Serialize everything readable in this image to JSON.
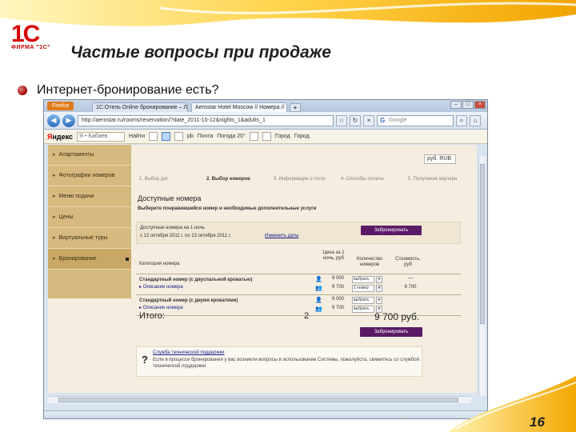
{
  "slide": {
    "title": "Частые вопросы при продаже",
    "bullet": "Интернет-бронирование есть?",
    "page_number": "16",
    "logo": "1С",
    "logo_sub": "ФИРМА \"1С\""
  },
  "browser": {
    "app_button": "Firefox",
    "tabs": [
      "1С:Отель Online бронирование – Л...",
      "Aerostar Hotel Moscow // Номера // ..."
    ],
    "url": "http://aerostar.ru/rooms/reservation/?date_2011-10-12&nights_1&adults_1",
    "search_placeholder": "Google",
    "yandex_logo_red": "Я",
    "yandex_logo_black": "ндекс",
    "yandex_input": "Я • Бабаев",
    "yandex_items": [
      "Найти",
      "pb",
      "Почта",
      "Погода 20°",
      "Город",
      "Город"
    ]
  },
  "sidebar": {
    "items": [
      {
        "label": "Апартаменты"
      },
      {
        "label": "Фотографии номеров"
      },
      {
        "label": "Меню подачи"
      },
      {
        "label": "Цены"
      },
      {
        "label": "Виртуальные туры"
      },
      {
        "label": "Бронирование"
      }
    ]
  },
  "booking": {
    "currency": "руб. RUB",
    "steps": [
      "1. Выбор дат",
      "2. Выбор номеров",
      "3. Информация о госте",
      "4. Способы оплаты",
      "5. Получение ваучера"
    ],
    "heading": "Доступные номера",
    "lead": "Выберите понравившийся номер и необходимые дополнительные услуги",
    "dates_label": "Доступные номера на 1 ночь",
    "dates_range": "с 12 октября 2011 г. по 13 октября 2011 г.",
    "change_dates": "Изменить даты",
    "book_button": "Забронировать",
    "columns": {
      "category": "Категория номера",
      "price": "Цена за 1 ночь, руб",
      "count": "Количество номеров",
      "cost": "Стоимость, руб"
    },
    "rooms": [
      {
        "name": "Стандартный номер (с двуспальной кроватью)",
        "link": "Описание номера",
        "rates": [
          {
            "people": "👤",
            "price": "9 000",
            "select": "выбрать",
            "cost": "—"
          },
          {
            "people": "👥",
            "price": "9 700",
            "select": "1 номер",
            "cost": "9 700"
          }
        ]
      },
      {
        "name": "Стандартный номер (с двумя кроватями)",
        "link": "Описание номера",
        "rates": [
          {
            "people": "👤",
            "price": "9 000",
            "select": "выбрать",
            "cost": ""
          },
          {
            "people": "👥",
            "price": "9 700",
            "select": "выбрать",
            "cost": ""
          }
        ]
      }
    ],
    "total_label": "Итого:",
    "total_count": "2",
    "total_sum": "9 700 руб.",
    "help_q": "?",
    "help_title": "Служба технической поддержки",
    "help_text": "Если в процессе бронирования у вас возникли вопросы в использовании Системы, пожалуйста, свяжитесь со службой технической поддержки"
  }
}
